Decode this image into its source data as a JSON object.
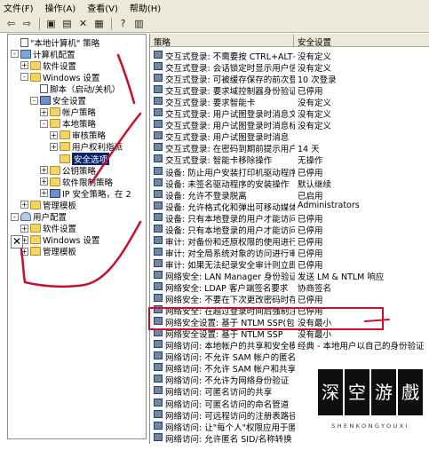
{
  "menu": [
    "文件(F)",
    "操作(A)",
    "查看(V)",
    "帮助(H)"
  ],
  "toolbar_icons": [
    "back-arrow-icon",
    "forward-arrow-icon",
    "up-folder-icon",
    "show-hide-tree-icon",
    "delete-icon",
    "properties-icon",
    "help-icon",
    "console-icon"
  ],
  "tree": [
    {
      "label": "\"本地计算机\" 策略",
      "level": 0,
      "toggle": "",
      "icon": "doc"
    },
    {
      "label": "计算机配置",
      "level": 0,
      "toggle": "-",
      "icon": "computer"
    },
    {
      "label": "软件设置",
      "level": 1,
      "toggle": "+",
      "icon": "folder"
    },
    {
      "label": "Windows 设置",
      "level": 1,
      "toggle": "-",
      "icon": "folder"
    },
    {
      "label": "脚本（启动/关机）",
      "level": 2,
      "toggle": "",
      "icon": "doc"
    },
    {
      "label": "安全设置",
      "level": 2,
      "toggle": "-",
      "icon": "shield"
    },
    {
      "label": "帐户策略",
      "level": 3,
      "toggle": "+",
      "icon": "folder"
    },
    {
      "label": "本地策略",
      "level": 3,
      "toggle": "-",
      "icon": "folder"
    },
    {
      "label": "审核策略",
      "level": 4,
      "toggle": "+",
      "icon": "folder"
    },
    {
      "label": "用户权利指派",
      "level": 4,
      "toggle": "+",
      "icon": "folder"
    },
    {
      "label": "安全选项",
      "level": 4,
      "toggle": "",
      "icon": "folder",
      "selected": true
    },
    {
      "label": "公钥策略",
      "level": 3,
      "toggle": "+",
      "icon": "folder"
    },
    {
      "label": "软件限制策略",
      "level": 3,
      "toggle": "+",
      "icon": "folder"
    },
    {
      "label": "IP 安全策略，在 2",
      "level": 3,
      "toggle": "+",
      "icon": "shield"
    },
    {
      "label": "管理模板",
      "level": 1,
      "toggle": "+",
      "icon": "folder"
    },
    {
      "label": "用户配置",
      "level": 0,
      "toggle": "-",
      "icon": "user"
    },
    {
      "label": "软件设置",
      "level": 1,
      "toggle": "+",
      "icon": "folder"
    },
    {
      "label": "Windows 设置",
      "level": 1,
      "toggle": "+",
      "icon": "folder"
    },
    {
      "label": "管理模板",
      "level": 1,
      "toggle": "+",
      "icon": "folder"
    }
  ],
  "side_tab": "✕",
  "list": {
    "headers": [
      "策略",
      "安全设置"
    ],
    "rows": [
      {
        "policy": "交互式登录: 不需要按 CTRL+ALT+DEL",
        "setting": "没有定义"
      },
      {
        "policy": "交互式登录: 会话锁定时显示用户信息",
        "setting": "没有定义"
      },
      {
        "policy": "交互式登录: 可被缓存保存的前次登录个数",
        "setting": "10 次登录"
      },
      {
        "policy": "交互式登录: 要求域控制器身份验证",
        "setting": "已停用"
      },
      {
        "policy": "交互式登录: 要求智能卡",
        "setting": "没有定义"
      },
      {
        "policy": "交互式登录: 用户试图登录时消息文字",
        "setting": "没有定义"
      },
      {
        "policy": "交互式登录: 用户试图登录时消息标题",
        "setting": "没有定义"
      },
      {
        "policy": "交互式登录: 用户试图登录时消息",
        "setting": ""
      },
      {
        "policy": "交互式登录: 在密码到期前提示用户更改",
        "setting": "14 天"
      },
      {
        "policy": "交互式登录: 智能卡移除操作",
        "setting": "无操作"
      },
      {
        "policy": "设备: 防止用户安装打印机驱动程序",
        "setting": "已停用"
      },
      {
        "policy": "设备: 未签名驱动程序的安装操作",
        "setting": "默认继续"
      },
      {
        "policy": "设备: 允许不登录脱离",
        "setting": "已启用"
      },
      {
        "policy": "设备: 允许格式化和弹出可移动媒体",
        "setting": "Administrators"
      },
      {
        "policy": "设备: 只有本地登录的用户才能访问软盘",
        "setting": "已停用"
      },
      {
        "policy": "设备: 只有本地登录的用户才能访问光盘",
        "setting": "已停用"
      },
      {
        "policy": "审计: 对备份和还原权限的使用进行审计",
        "setting": "已停用"
      },
      {
        "policy": "审计: 对全局系统对象的访问进行审计",
        "setting": "已停用"
      },
      {
        "policy": "审计: 如果无法纪录安全审计则立即关闭",
        "setting": "已停用"
      },
      {
        "policy": "网络安全: LAN Manager 身份验证级别",
        "setting": "发送 LM & NTLM 响应"
      },
      {
        "policy": "网络安全: LDAP 客户端签名要求",
        "setting": "协商签名"
      },
      {
        "policy": "网络安全: 不要在下次更改密码时存储",
        "setting": "已停用"
      },
      {
        "policy": "网络安全: 在超过登录时间后强制注销",
        "setting": "已停用"
      },
      {
        "policy": "网络安全设置: 基于 NTLM SSP(包括",
        "setting": "没有最小"
      },
      {
        "policy": "网络安全设置: 基于 NTLM SSP",
        "setting": "没有最小"
      },
      {
        "policy": "网络访问: 本地帐户的共享和安全模式",
        "setting": "经典 - 本地用户以自己的身份验证"
      },
      {
        "policy": "网络访问: 不允许 SAM 帐户的匿名枚举",
        "setting": ""
      },
      {
        "policy": "网络访问: 不允许 SAM 帐户和共享",
        "setting": ""
      },
      {
        "policy": "网络访问: 不允许为网络身份验证",
        "setting": ""
      },
      {
        "policy": "网络访问: 可匿名访问的共享",
        "setting": ""
      },
      {
        "policy": "网络访问: 可匿名访问的命名管道",
        "setting": ""
      },
      {
        "policy": "网络访问: 可远程访问的注册表路径",
        "setting": ""
      },
      {
        "policy": "网络访问: 让\"每个人\"权限应用于匿名用户",
        "setting": ""
      },
      {
        "policy": "网络访问: 允许匿名 SID/名称转换",
        "setting": ""
      }
    ]
  },
  "watermark": {
    "chars": [
      "深",
      "空",
      "游",
      "戲"
    ],
    "latin": "SHENKONGYOUXI"
  },
  "annotation_color": "#c8102e"
}
